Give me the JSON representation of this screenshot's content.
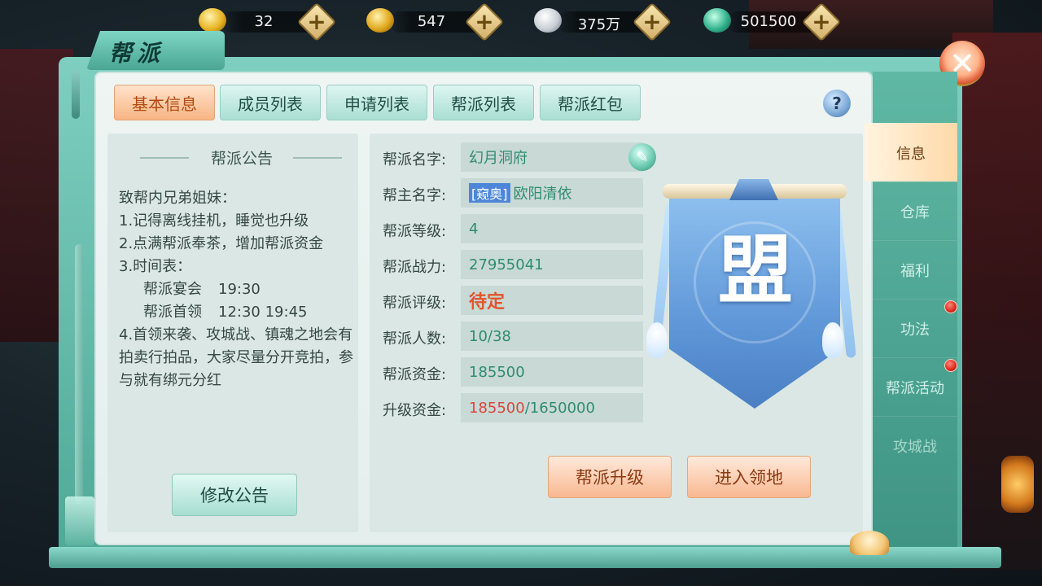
{
  "currency": [
    {
      "icon": "gold-ingot-icon",
      "value": "32"
    },
    {
      "icon": "bound-gold-ingot-icon",
      "value": "547"
    },
    {
      "icon": "silver-ingot-icon",
      "value": "375万"
    },
    {
      "icon": "jade-coin-icon",
      "value": "501500"
    }
  ],
  "currency_plus": "+",
  "title": "帮派",
  "close_label": "✕",
  "tabs": [
    "基本信息",
    "成员列表",
    "申请列表",
    "帮派列表",
    "帮派红包"
  ],
  "help_label": "?",
  "notice": {
    "title": "帮派公告",
    "lines": [
      "致帮内兄弟姐妹：",
      "1.记得离线挂机，睡觉也升级",
      "2.点满帮派奉茶，增加帮派资金",
      "3.时间表："
    ],
    "schedule": [
      {
        "name": "帮派宴会",
        "time": "19:30"
      },
      {
        "name": "帮派首领",
        "time": "12:30  19:45"
      }
    ],
    "tail": "4.首领来袭、攻城战、镇魂之地会有拍卖行拍品，大家尽量分开竞拍，参与就有绑元分红",
    "edit_button": "修改公告"
  },
  "info": {
    "rows": [
      {
        "label": "帮派名字:",
        "value": "幻月洞府"
      },
      {
        "label": "帮主名字:",
        "badge": "[窥奥]",
        "value": "欧阳清依"
      },
      {
        "label": "帮派等级:",
        "value": "4"
      },
      {
        "label": "帮派战力:",
        "value": "27955041"
      },
      {
        "label": "帮派评级:",
        "value": "待定"
      },
      {
        "label": "帮派人数:",
        "value": "10/38"
      },
      {
        "label": "帮派资金:",
        "value": "185500"
      },
      {
        "label": "升级资金:",
        "current": "185500",
        "target": "/1650000"
      }
    ],
    "banner_char": "盟",
    "upgrade_button": "帮派升级",
    "enter_button": "进入领地"
  },
  "side_nav": [
    "信息",
    "仓库",
    "福利",
    "功法",
    "帮派活动",
    "攻城战"
  ],
  "colors": {
    "accent": "#4fa796",
    "active_tab": "#f7b583",
    "value_green": "#2f8c71",
    "value_red": "#d8473d"
  }
}
